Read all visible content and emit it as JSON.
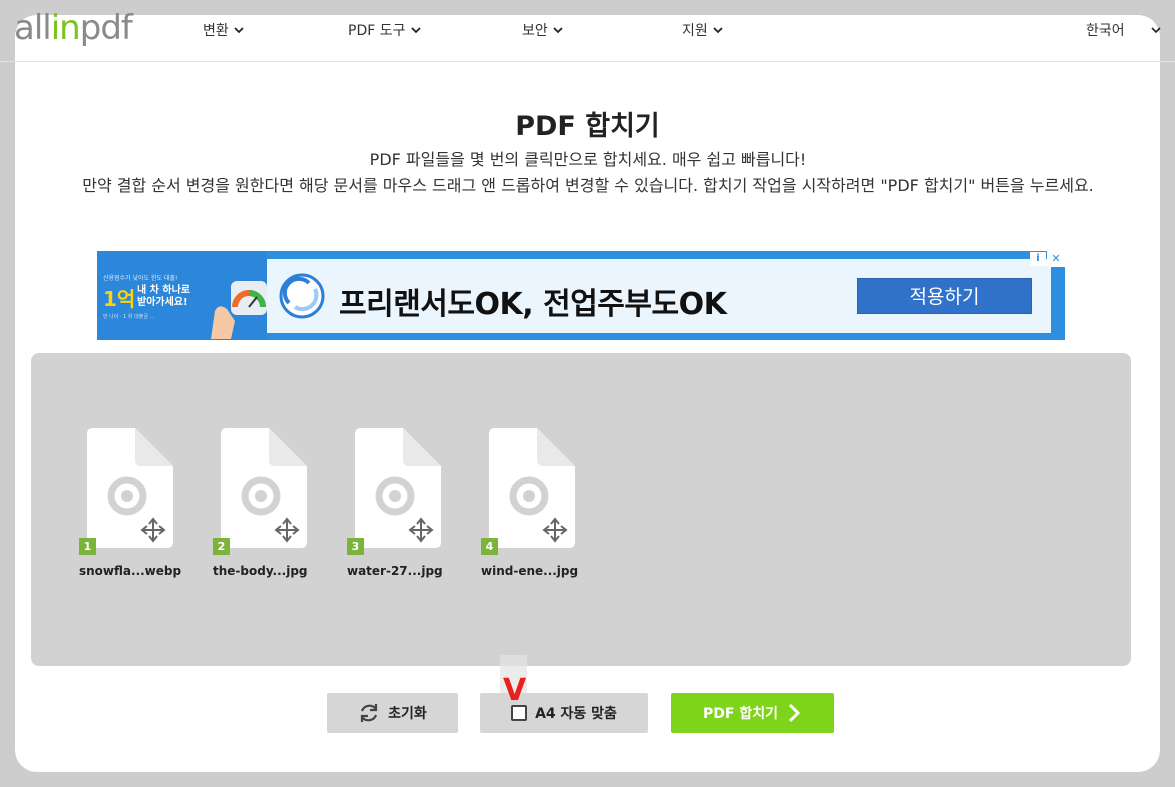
{
  "header": {
    "logo_prefix": "all",
    "logo_in": "in",
    "logo_suffix": "pdf",
    "nav": [
      {
        "label": "변환"
      },
      {
        "label": "PDF 도구"
      },
      {
        "label": "보안"
      },
      {
        "label": "지원"
      }
    ],
    "language": "한국어"
  },
  "main": {
    "title": "PDF 합치기",
    "description_line1": "PDF 파일들을 몇 번의 클릭만으로 합치세요. 매우 쉽고 빠릅니다!",
    "description_line2": "만약 결합 순서 변경을 원한다면 해당 문서를 마우스 드래그 앤 드롭하여 변경할 수 있습니다. 합치기 작업을 시작하려면 \"PDF 합치기\" 버튼을 누르세요."
  },
  "ad": {
    "left_small": "신용점수가 낮아도 한도 대출!",
    "left_big": "1억",
    "left_sub_line1": "내 차 하나로",
    "left_sub_line2": "받아가세요!",
    "left_tiny": "만 나이 · 1 위 대출금 ...",
    "headline": "프리랜서도OK, 전업주부도OK",
    "button": "적용하기",
    "info": "i",
    "close": "✕"
  },
  "files": [
    {
      "index": "1",
      "name": "snowfla...webp"
    },
    {
      "index": "2",
      "name": "the-body...jpg"
    },
    {
      "index": "3",
      "name": "water-27...jpg"
    },
    {
      "index": "4",
      "name": "wind-ene...jpg"
    }
  ],
  "actions": {
    "reset_label": "초기화",
    "a4_label": "A4 자동 맞춤",
    "a4_checked": false,
    "merge_label": "PDF 합치기",
    "annotation_mark": "V"
  },
  "colors": {
    "accent_green": "#7ed31b",
    "badge_green": "#7cb33b",
    "annotation_red": "#e8221b"
  }
}
